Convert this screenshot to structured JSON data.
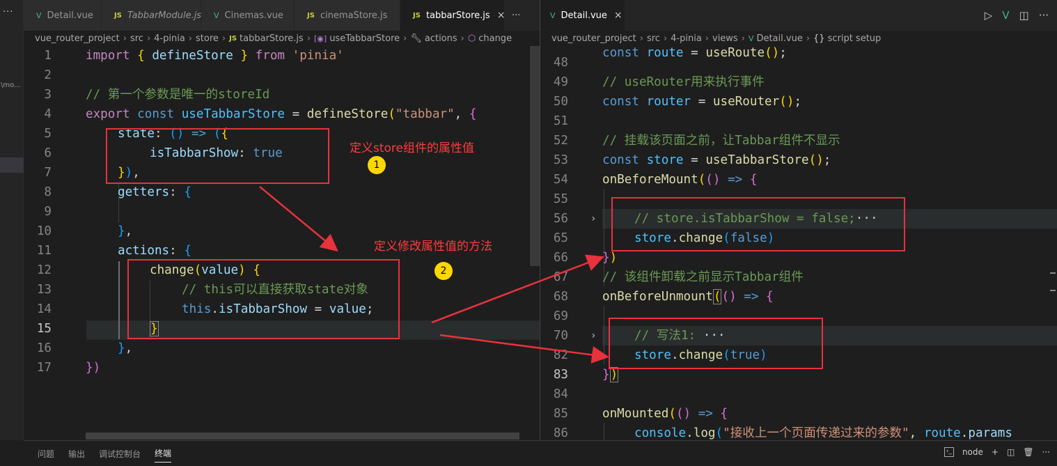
{
  "sidebar": {
    "menu": "···",
    "path": "\\mo..."
  },
  "left_tabs": [
    {
      "label": "Detail.vue",
      "kind": "vue"
    },
    {
      "label": "TabbarModule.js",
      "kind": "js",
      "italic": true
    },
    {
      "label": "Cinemas.vue",
      "kind": "vue"
    },
    {
      "label": "cinemaStore.js",
      "kind": "js"
    },
    {
      "label": "tabbarStore.js",
      "kind": "js",
      "active": true
    }
  ],
  "left_more": "···",
  "right_tab": {
    "label": "Detail.vue",
    "kind": "vue"
  },
  "icons": {
    "vue": "V",
    "js": "JS",
    "close": "×",
    "run": "▷",
    "split": "◫",
    "more": "···"
  },
  "left_crumbs": [
    "vue_router_project",
    "src",
    "4-pinia",
    "store",
    "tabbarStore.js",
    "useTabbarStore",
    "actions",
    "change"
  ],
  "right_crumbs": [
    "vue_router_project",
    "src",
    "4-pinia",
    "views",
    "Detail.vue",
    "script setup"
  ],
  "left_lines": [
    "1",
    "2",
    "3",
    "4",
    "5",
    "6",
    "7",
    "8",
    "9",
    "10",
    "11",
    "12",
    "13",
    "14",
    "15",
    "16",
    "17"
  ],
  "right_lines": [
    "48",
    "49",
    "50",
    "51",
    "52",
    "53",
    "54",
    "55",
    "56",
    "65",
    "66",
    "67",
    "68",
    "69",
    "70",
    "82",
    "83",
    "84",
    "85",
    "86"
  ],
  "annotations": {
    "note1": "定义store组件的属性值",
    "note2": "定义修改属性值的方法",
    "badge1": "1",
    "badge2": "2"
  },
  "bottom": {
    "tabs": [
      "问题",
      "输出",
      "调试控制台",
      "终端"
    ],
    "terminal": "node"
  },
  "colors": {
    "annotation": "#e8323c",
    "badge": "#ffd700"
  }
}
